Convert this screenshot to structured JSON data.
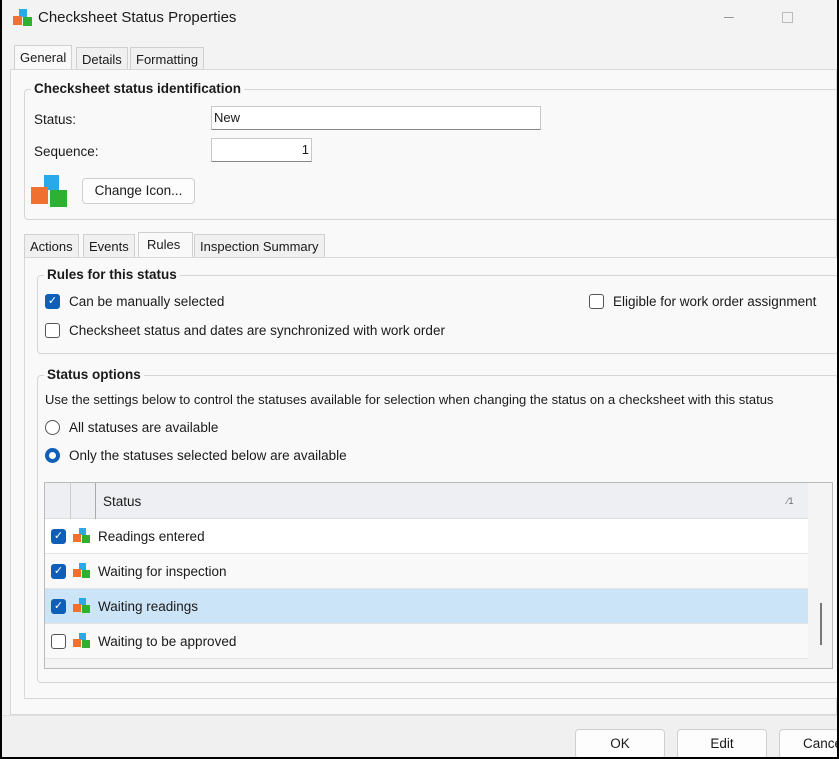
{
  "window": {
    "title": "Checksheet Status Properties",
    "icon": "cubes-icon"
  },
  "tabs": [
    {
      "label": "General",
      "selected": true
    },
    {
      "label": "Details"
    },
    {
      "label": "Formatting"
    }
  ],
  "identification": {
    "legend": "Checksheet status identification",
    "status_label": "Status:",
    "status_value": "New",
    "sequence_label": "Sequence:",
    "sequence_value": "1",
    "change_icon_label": "Change Icon..."
  },
  "inner_tabs": [
    {
      "label": "Actions"
    },
    {
      "label": "Events"
    },
    {
      "label": "Rules",
      "selected": true
    },
    {
      "label": "Inspection Summary"
    }
  ],
  "rules": {
    "legend": "Rules for this status",
    "manual": {
      "label": "Can be manually selected",
      "checked": true
    },
    "eligible": {
      "label": "Eligible for work order assignment",
      "checked": false
    },
    "sync": {
      "label": "Checksheet status and dates are synchronized with work order",
      "checked": false
    }
  },
  "status_options": {
    "legend": "Status options",
    "description": "Use the settings below to control the statuses available for selection when changing the status on a checksheet with this status",
    "all_label": "All statuses are available",
    "only_label": "Only the statuses selected below are available",
    "selected_option": "only"
  },
  "grid": {
    "header": "Status",
    "sort_indicator": "1",
    "rows": [
      {
        "label": "Readings entered",
        "checked": true
      },
      {
        "label": "Waiting for inspection",
        "checked": true
      },
      {
        "label": "Waiting readings",
        "checked": true,
        "selected": true
      },
      {
        "label": "Waiting to be approved",
        "checked": false
      }
    ]
  },
  "footer": {
    "ok": "OK",
    "edit": "Edit",
    "cancel": "Cancel"
  },
  "colors": {
    "accent": "#0f5fb8",
    "selected_row": "#cce4f7"
  }
}
